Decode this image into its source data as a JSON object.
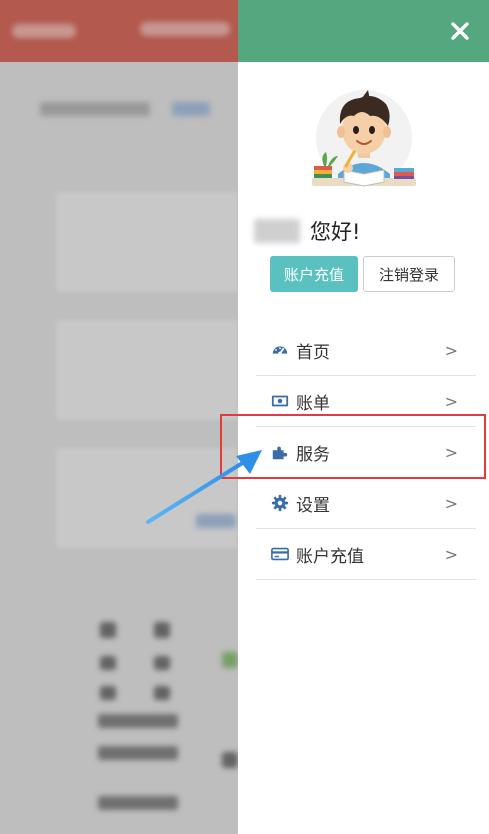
{
  "drawer": {
    "greeting": "您好!",
    "buttons": {
      "recharge": "账户充值",
      "logout": "注销登录"
    },
    "menu": [
      {
        "label": "首页",
        "icon": "dashboard-icon",
        "arrow": ">"
      },
      {
        "label": "账单",
        "icon": "money-bill-icon",
        "arrow": ">"
      },
      {
        "label": "服务",
        "icon": "puzzle-icon",
        "arrow": ">"
      },
      {
        "label": "设置",
        "icon": "gear-icon",
        "arrow": ">"
      },
      {
        "label": "账户充值",
        "icon": "credit-card-icon",
        "arrow": ">"
      }
    ]
  },
  "colors": {
    "header_green": "#55a77f",
    "button_teal": "#5bc0c0",
    "icon_blue": "#3a6da8",
    "highlight_red": "#e23b3b",
    "arrow_blue": "#2f8fe6",
    "bg_header_red": "#c0493a"
  }
}
